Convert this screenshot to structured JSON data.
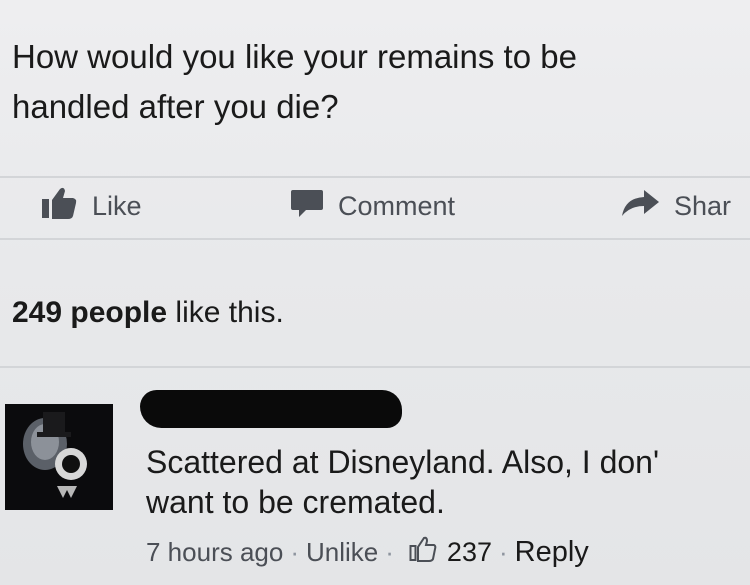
{
  "post": {
    "text_line1": "How would you like your remains to be",
    "text_line2": "handled after you die?"
  },
  "actions": {
    "like_label": "Like",
    "comment_label": "Comment",
    "share_label": "Shar"
  },
  "likes_summary": {
    "count_text": "249 people",
    "suffix": " like this."
  },
  "comment": {
    "line1": "Scattered at Disneyland. Also, I don'",
    "line2": "want to be cremated.",
    "timestamp": "7 hours ago",
    "unlike_label": "Unlike",
    "like_count": "237",
    "reply_label": "Reply",
    "separator": "·"
  },
  "icons": {
    "like": "thumbs-up-icon",
    "comment": "speech-bubble-icon",
    "share": "share-arrow-icon",
    "comment_like": "thumbs-up-outline-icon"
  },
  "colors": {
    "background": "#e9eaec",
    "action_text": "#4b4f56",
    "meta_text": "#6d7178"
  }
}
